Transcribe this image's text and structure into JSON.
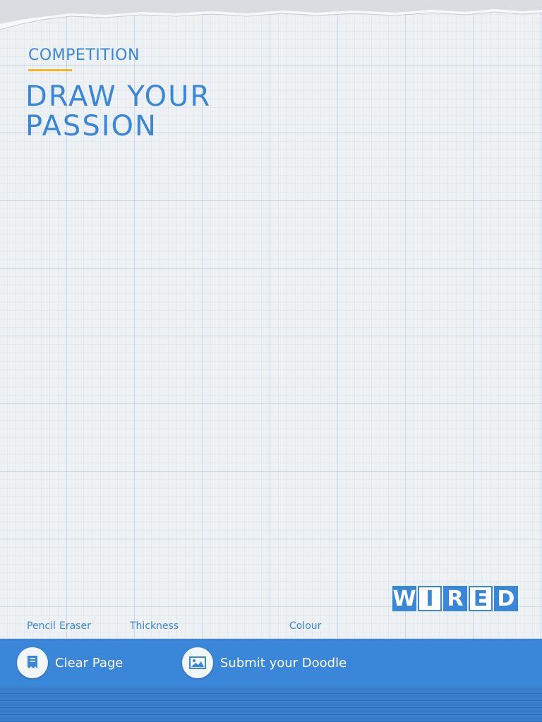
{
  "competition": {
    "kicker": "COMPETITION",
    "headline_line1": "DRAW YOUR",
    "headline_line2": "PASSION"
  },
  "branding": {
    "logo_letters": [
      "W",
      "I",
      "R",
      "E",
      "D"
    ],
    "accent_color": "#3a86d8",
    "underline_color": "#f2b72b"
  },
  "toolbar": {
    "pencil_label": "Pencil",
    "eraser_label": "Eraser",
    "thickness_label": "Thickness",
    "colour_label": "Colour"
  },
  "actions": {
    "clear_label": "Clear Page",
    "clear_icon": "clear-page-icon",
    "submit_label": "Submit your Doodle",
    "submit_icon": "image-icon"
  }
}
